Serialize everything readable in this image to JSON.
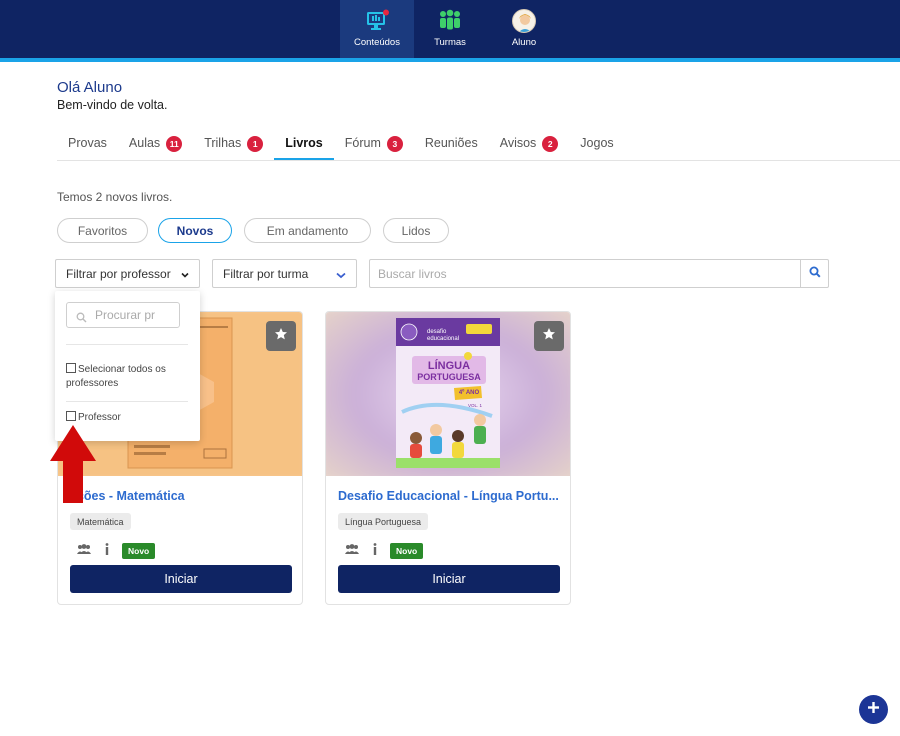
{
  "nav": {
    "items": [
      {
        "label": "Conteúdos",
        "icon": "monitor-icon",
        "active": true
      },
      {
        "label": "Turmas",
        "icon": "people-icon",
        "active": false
      },
      {
        "label": "Aluno",
        "icon": "avatar",
        "active": false
      }
    ]
  },
  "greeting": {
    "title": "Olá Aluno",
    "subtitle": "Bem-vindo de volta."
  },
  "tabs": [
    {
      "label": "Provas",
      "badge": null
    },
    {
      "label": "Aulas",
      "badge": "11"
    },
    {
      "label": "Trilhas",
      "badge": "1"
    },
    {
      "label": "Livros",
      "badge": null,
      "active": true
    },
    {
      "label": "Fórum",
      "badge": "3"
    },
    {
      "label": "Reuniões",
      "badge": null
    },
    {
      "label": "Avisos",
      "badge": "2"
    },
    {
      "label": "Jogos",
      "badge": null
    }
  ],
  "info": "Temos 2 novos livros.",
  "filters": {
    "pills": [
      "Favoritos",
      "Novos",
      "Em andamento",
      "Lidos"
    ],
    "active_pill": "Novos",
    "professor_select": "Filtrar por professor",
    "turma_select": "Filtrar por turma",
    "search_placeholder": "Buscar livros"
  },
  "dropdown": {
    "search_placeholder": "Procurar pr",
    "select_all": "Selecionar todos os professores",
    "option": "Professor"
  },
  "cards": [
    {
      "title": "ações - Matemática",
      "tag": "Matemática",
      "badge": "Novo",
      "button": "Iniciar"
    },
    {
      "title": "Desafio Educacional - Língua Portu...",
      "tag": "Língua Portuguesa",
      "badge": "Novo",
      "button": "Iniciar",
      "cover": {
        "brand": "desafio educacional",
        "title_line1": "LÍNGUA",
        "title_line2": "PORTUGUESA",
        "year": "4º ANO",
        "vol": "VOL. 1"
      }
    }
  ],
  "colors": {
    "topbar": "#0f2463",
    "accent": "#1aa3e8",
    "badge": "#d9213e",
    "primary_button": "#0f2463",
    "novo_badge": "#2a8a2a",
    "link": "#2d6bcf",
    "arrow": "#d10a0a"
  }
}
